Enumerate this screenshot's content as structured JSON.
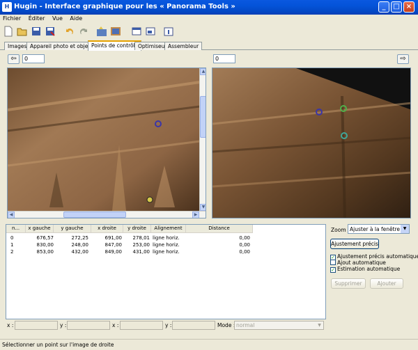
{
  "window": {
    "title": "Hugin - Interface graphique pour les « Panorama Tools »",
    "app_icon_text": "H"
  },
  "menu": [
    "Fichier",
    "Éditer",
    "Vue",
    "Aide"
  ],
  "tabs": [
    "Images",
    "Appareil photo et objectif",
    "Points de contrôle",
    "Optimiseur",
    "Assembleur"
  ],
  "active_tab": "Points de contrôle",
  "left_panel": {
    "image_number": "0",
    "nav_arrow": "⇦"
  },
  "right_panel": {
    "image_number": "0",
    "nav_arrow": "⇨"
  },
  "table": {
    "headers": [
      "n...",
      "x gauche",
      "y gauche",
      "x droite",
      "y droite",
      "Alignement",
      "Distance"
    ],
    "rows": [
      [
        "0",
        "676,57",
        "272,25",
        "691,00",
        "278,01",
        "ligne horiz.",
        "0,00"
      ],
      [
        "1",
        "830,00",
        "248,00",
        "847,00",
        "253,00",
        "ligne horiz.",
        "0,00"
      ],
      [
        "2",
        "853,00",
        "432,00",
        "849,00",
        "431,00",
        "ligne horiz.",
        "0,00"
      ]
    ]
  },
  "zoom": {
    "label": "Zoom :",
    "value": "Ajuster à la fenêtre"
  },
  "buttons": {
    "fine_tune": "Ajustement précis",
    "delete": "Supprimer",
    "add": "Ajouter"
  },
  "checkboxes": [
    {
      "label": "Ajustement précis automatique",
      "checked": true
    },
    {
      "label": "Ajout automatique",
      "checked": false
    },
    {
      "label": "Estimation automatique",
      "checked": true
    }
  ],
  "coords": {
    "x1_label": "x :",
    "y1_label": "y :",
    "x2_label": "x :",
    "y2_label": "y :",
    "mode_label": "Mode :",
    "mode_value": "normal"
  },
  "status": "Sélectionner un point sur l'image de droite",
  "control_point_colors": {
    "point_0": "#3a35a8",
    "point_1": "#4fb04a",
    "point_2": "#3fa79a",
    "left_point_2": "#d6c94a"
  }
}
